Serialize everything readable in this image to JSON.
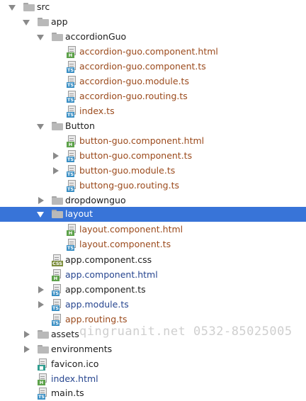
{
  "tree": {
    "items": [
      {
        "label": "src",
        "kind": "folder",
        "arrow": "down",
        "color": "default"
      },
      {
        "label": "app",
        "kind": "folder",
        "arrow": "down",
        "color": "default"
      },
      {
        "label": "accordionGuo",
        "kind": "folder",
        "arrow": "down",
        "color": "default"
      },
      {
        "label": "accordion-guo.component.html",
        "kind": "file",
        "badge": "H",
        "color": "brown"
      },
      {
        "label": "accordion-guo.component.ts",
        "kind": "file",
        "badge": "TS",
        "color": "brown"
      },
      {
        "label": "accordion-guo.module.ts",
        "kind": "file",
        "badge": "TS",
        "color": "brown"
      },
      {
        "label": "accordion-guo.routing.ts",
        "kind": "file",
        "badge": "TS",
        "color": "brown"
      },
      {
        "label": "index.ts",
        "kind": "file",
        "badge": "TS",
        "color": "brown"
      },
      {
        "label": "Button",
        "kind": "folder",
        "arrow": "down",
        "color": "default"
      },
      {
        "label": "button-guo.component.html",
        "kind": "file",
        "badge": "H",
        "color": "brown"
      },
      {
        "label": "button-guo.component.ts",
        "kind": "file",
        "badge": "TS",
        "color": "brown",
        "arrow": "right"
      },
      {
        "label": "button-guo.module.ts",
        "kind": "file",
        "badge": "TS",
        "color": "brown",
        "arrow": "right"
      },
      {
        "label": "buttong-guo.routing.ts",
        "kind": "file",
        "badge": "TS",
        "color": "brown"
      },
      {
        "label": "dropdownguo",
        "kind": "folder",
        "arrow": "right",
        "color": "default"
      },
      {
        "label": "layout",
        "kind": "folder",
        "arrow": "down",
        "color": "default",
        "selected": true
      },
      {
        "label": "layout.component.html",
        "kind": "file",
        "badge": "H",
        "color": "brown"
      },
      {
        "label": "layout.component.ts",
        "kind": "file",
        "badge": "TS",
        "color": "brown"
      },
      {
        "label": "app.component.css",
        "kind": "file",
        "badge": "CSS",
        "color": "default"
      },
      {
        "label": "app.component.html",
        "kind": "file",
        "badge": "H",
        "color": "blue"
      },
      {
        "label": "app.component.ts",
        "kind": "file",
        "badge": "TS",
        "color": "default",
        "arrow": "right"
      },
      {
        "label": "app.module.ts",
        "kind": "file",
        "badge": "TS",
        "color": "blue",
        "arrow": "right"
      },
      {
        "label": "app.routing.ts",
        "kind": "file",
        "badge": "TS",
        "color": "brown"
      },
      {
        "label": "assets",
        "kind": "folder",
        "arrow": "right",
        "color": "default"
      },
      {
        "label": "environments",
        "kind": "folder",
        "arrow": "right",
        "color": "default"
      },
      {
        "label": "favicon.ico",
        "kind": "file",
        "badge": "ICO",
        "color": "default"
      },
      {
        "label": "index.html",
        "kind": "file",
        "badge": "H",
        "color": "blue"
      },
      {
        "label": "main.ts",
        "kind": "file",
        "badge": "TS",
        "color": "default"
      }
    ]
  },
  "watermark": "qingruanit.net 0532-85025005"
}
